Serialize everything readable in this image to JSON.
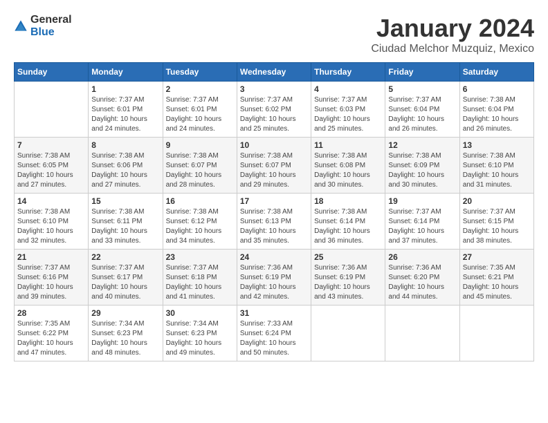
{
  "header": {
    "logo_general": "General",
    "logo_blue": "Blue",
    "month_title": "January 2024",
    "subtitle": "Ciudad Melchor Muzquiz, Mexico"
  },
  "days_of_week": [
    "Sunday",
    "Monday",
    "Tuesday",
    "Wednesday",
    "Thursday",
    "Friday",
    "Saturday"
  ],
  "weeks": [
    [
      {
        "day": "",
        "info": ""
      },
      {
        "day": "1",
        "info": "Sunrise: 7:37 AM\nSunset: 6:01 PM\nDaylight: 10 hours\nand 24 minutes."
      },
      {
        "day": "2",
        "info": "Sunrise: 7:37 AM\nSunset: 6:01 PM\nDaylight: 10 hours\nand 24 minutes."
      },
      {
        "day": "3",
        "info": "Sunrise: 7:37 AM\nSunset: 6:02 PM\nDaylight: 10 hours\nand 25 minutes."
      },
      {
        "day": "4",
        "info": "Sunrise: 7:37 AM\nSunset: 6:03 PM\nDaylight: 10 hours\nand 25 minutes."
      },
      {
        "day": "5",
        "info": "Sunrise: 7:37 AM\nSunset: 6:04 PM\nDaylight: 10 hours\nand 26 minutes."
      },
      {
        "day": "6",
        "info": "Sunrise: 7:38 AM\nSunset: 6:04 PM\nDaylight: 10 hours\nand 26 minutes."
      }
    ],
    [
      {
        "day": "7",
        "info": "Sunrise: 7:38 AM\nSunset: 6:05 PM\nDaylight: 10 hours\nand 27 minutes."
      },
      {
        "day": "8",
        "info": "Sunrise: 7:38 AM\nSunset: 6:06 PM\nDaylight: 10 hours\nand 27 minutes."
      },
      {
        "day": "9",
        "info": "Sunrise: 7:38 AM\nSunset: 6:07 PM\nDaylight: 10 hours\nand 28 minutes."
      },
      {
        "day": "10",
        "info": "Sunrise: 7:38 AM\nSunset: 6:07 PM\nDaylight: 10 hours\nand 29 minutes."
      },
      {
        "day": "11",
        "info": "Sunrise: 7:38 AM\nSunset: 6:08 PM\nDaylight: 10 hours\nand 30 minutes."
      },
      {
        "day": "12",
        "info": "Sunrise: 7:38 AM\nSunset: 6:09 PM\nDaylight: 10 hours\nand 30 minutes."
      },
      {
        "day": "13",
        "info": "Sunrise: 7:38 AM\nSunset: 6:10 PM\nDaylight: 10 hours\nand 31 minutes."
      }
    ],
    [
      {
        "day": "14",
        "info": "Sunrise: 7:38 AM\nSunset: 6:10 PM\nDaylight: 10 hours\nand 32 minutes."
      },
      {
        "day": "15",
        "info": "Sunrise: 7:38 AM\nSunset: 6:11 PM\nDaylight: 10 hours\nand 33 minutes."
      },
      {
        "day": "16",
        "info": "Sunrise: 7:38 AM\nSunset: 6:12 PM\nDaylight: 10 hours\nand 34 minutes."
      },
      {
        "day": "17",
        "info": "Sunrise: 7:38 AM\nSunset: 6:13 PM\nDaylight: 10 hours\nand 35 minutes."
      },
      {
        "day": "18",
        "info": "Sunrise: 7:38 AM\nSunset: 6:14 PM\nDaylight: 10 hours\nand 36 minutes."
      },
      {
        "day": "19",
        "info": "Sunrise: 7:37 AM\nSunset: 6:14 PM\nDaylight: 10 hours\nand 37 minutes."
      },
      {
        "day": "20",
        "info": "Sunrise: 7:37 AM\nSunset: 6:15 PM\nDaylight: 10 hours\nand 38 minutes."
      }
    ],
    [
      {
        "day": "21",
        "info": "Sunrise: 7:37 AM\nSunset: 6:16 PM\nDaylight: 10 hours\nand 39 minutes."
      },
      {
        "day": "22",
        "info": "Sunrise: 7:37 AM\nSunset: 6:17 PM\nDaylight: 10 hours\nand 40 minutes."
      },
      {
        "day": "23",
        "info": "Sunrise: 7:37 AM\nSunset: 6:18 PM\nDaylight: 10 hours\nand 41 minutes."
      },
      {
        "day": "24",
        "info": "Sunrise: 7:36 AM\nSunset: 6:19 PM\nDaylight: 10 hours\nand 42 minutes."
      },
      {
        "day": "25",
        "info": "Sunrise: 7:36 AM\nSunset: 6:19 PM\nDaylight: 10 hours\nand 43 minutes."
      },
      {
        "day": "26",
        "info": "Sunrise: 7:36 AM\nSunset: 6:20 PM\nDaylight: 10 hours\nand 44 minutes."
      },
      {
        "day": "27",
        "info": "Sunrise: 7:35 AM\nSunset: 6:21 PM\nDaylight: 10 hours\nand 45 minutes."
      }
    ],
    [
      {
        "day": "28",
        "info": "Sunrise: 7:35 AM\nSunset: 6:22 PM\nDaylight: 10 hours\nand 47 minutes."
      },
      {
        "day": "29",
        "info": "Sunrise: 7:34 AM\nSunset: 6:23 PM\nDaylight: 10 hours\nand 48 minutes."
      },
      {
        "day": "30",
        "info": "Sunrise: 7:34 AM\nSunset: 6:23 PM\nDaylight: 10 hours\nand 49 minutes."
      },
      {
        "day": "31",
        "info": "Sunrise: 7:33 AM\nSunset: 6:24 PM\nDaylight: 10 hours\nand 50 minutes."
      },
      {
        "day": "",
        "info": ""
      },
      {
        "day": "",
        "info": ""
      },
      {
        "day": "",
        "info": ""
      }
    ]
  ]
}
